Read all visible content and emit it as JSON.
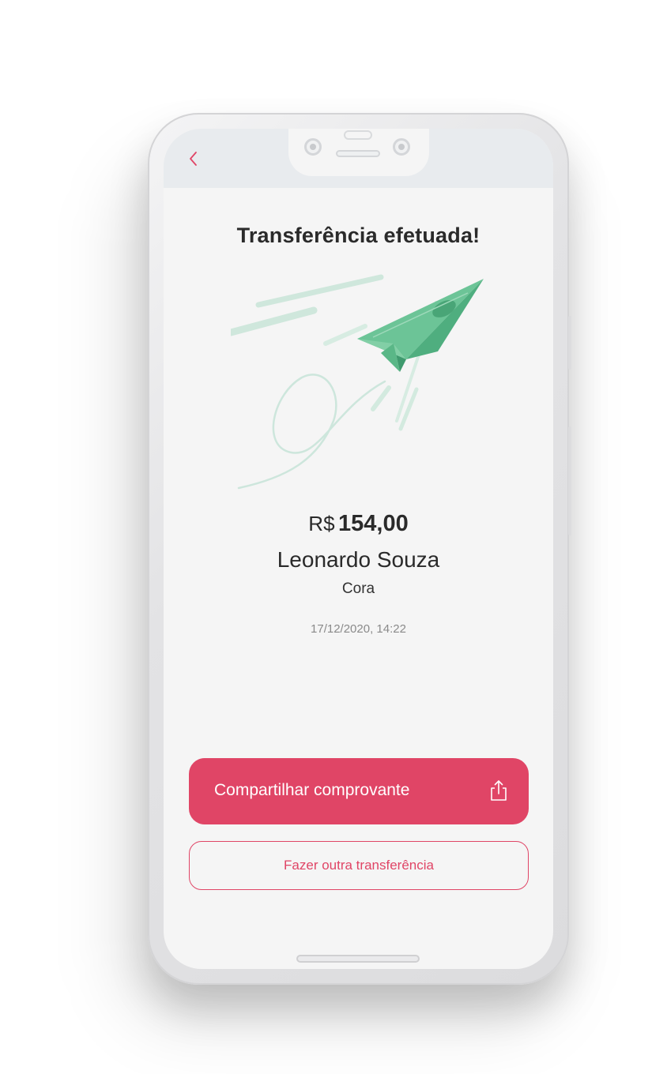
{
  "screen": {
    "title": "Transferência efetuada!",
    "amount": {
      "currency": "R$",
      "value": "154,00"
    },
    "recipient_name": "Leonardo Souza",
    "recipient_bank": "Cora",
    "datetime": "17/12/2020, 14:22"
  },
  "actions": {
    "share_label": "Compartilhar comprovante",
    "new_transfer_label": "Fazer outra transferência"
  },
  "icons": {
    "back": "chevron-left-icon",
    "share": "share-icon",
    "illustration": "paper-plane-money-icon"
  },
  "colors": {
    "accent": "#e04566",
    "text": "#2a2a2a",
    "muted": "#8a8a8a",
    "status_bar": "#e8ebee",
    "background": "#f5f5f5",
    "plane_green": "#5cb887"
  }
}
